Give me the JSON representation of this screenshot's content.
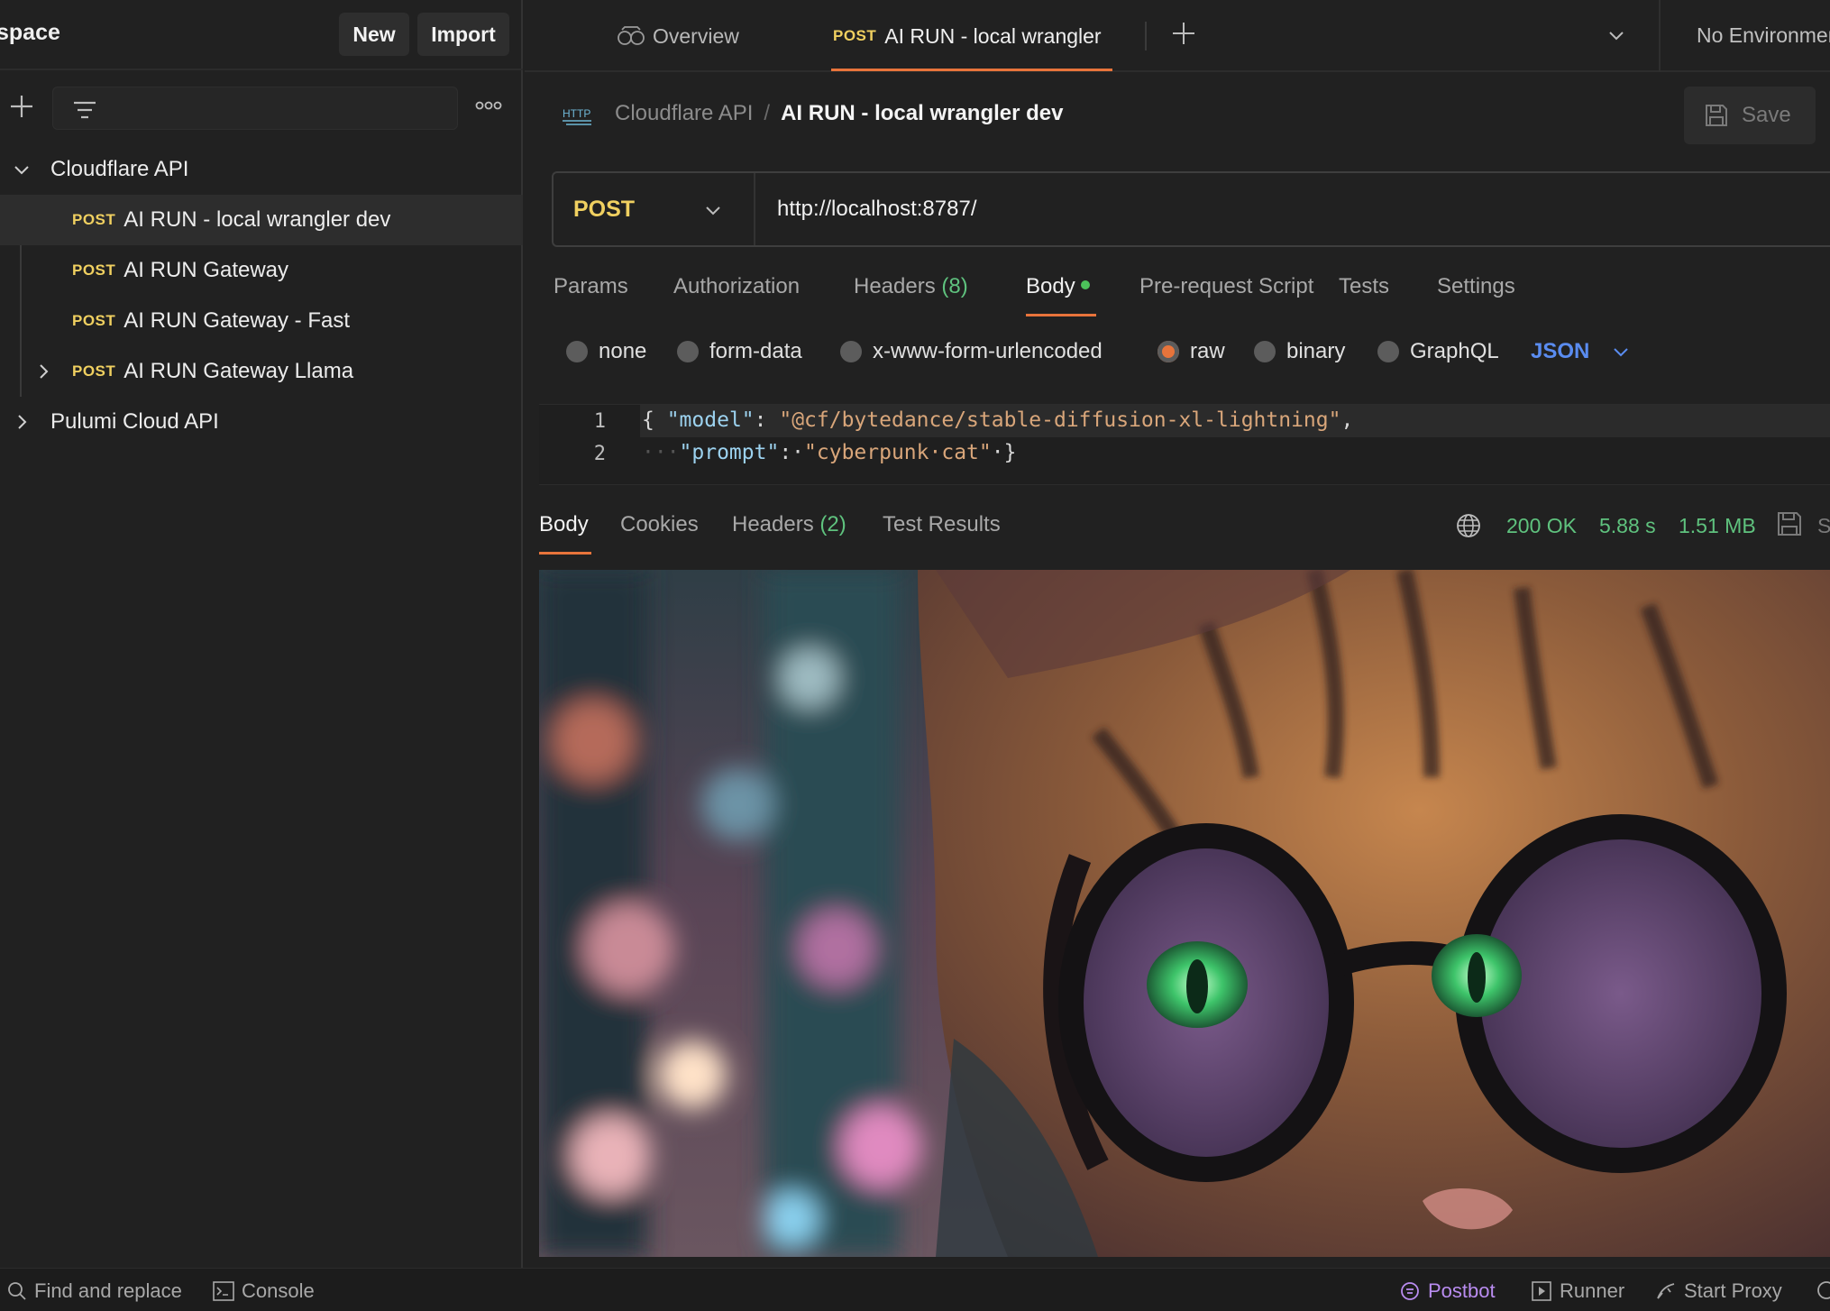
{
  "sidebar": {
    "workspace_title": "space",
    "new_label": "New",
    "import_label": "Import",
    "tree": [
      {
        "label": "Cloudflare API",
        "type": "collection",
        "expanded": true
      },
      {
        "method": "POST",
        "label": "AI RUN - local wrangler dev",
        "selected": true
      },
      {
        "method": "POST",
        "label": "AI RUN Gateway"
      },
      {
        "method": "POST",
        "label": "AI RUN Gateway - Fast"
      },
      {
        "method": "POST",
        "label": "AI RUN Gateway Llama",
        "expandable": true
      },
      {
        "label": "Pulumi Cloud API",
        "type": "collection",
        "expanded": false
      }
    ]
  },
  "tabs": {
    "overview_label": "Overview",
    "active_method": "POST",
    "active_label": "AI RUN - local wrangler",
    "environment": "No Environment"
  },
  "request": {
    "breadcrumb_parent": "Cloudflare API",
    "breadcrumb_separator": "/",
    "breadcrumb_current": "AI RUN - local wrangler dev",
    "http_icon_text": "HTTP",
    "save_label": "Save",
    "method": "POST",
    "url": "http://localhost:8787/",
    "subtabs": {
      "params": "Params",
      "authorization": "Authorization",
      "headers": "Headers",
      "headers_count": "(8)",
      "body": "Body",
      "prerequest": "Pre-request Script",
      "tests": "Tests",
      "settings": "Settings"
    },
    "body_types": {
      "none": "none",
      "form_data": "form-data",
      "urlencoded": "x-www-form-urlencoded",
      "raw": "raw",
      "binary": "binary",
      "graphql": "GraphQL",
      "selected": "raw",
      "format": "JSON"
    },
    "code": {
      "line1_no": "1",
      "line2_no": "2",
      "l1_open": "{ ",
      "l1_key": "\"model\"",
      "l1_colon": ": ",
      "l1_value": "\"@cf/bytedance/stable-diffusion-xl-lightning\"",
      "l1_comma": ",",
      "l2_indent": "···",
      "l2_key": "\"prompt\"",
      "l2_colon": ":·",
      "l2_value": "\"cyberpunk·cat\"",
      "l2_close": "·}"
    }
  },
  "response": {
    "tabs": {
      "body": "Body",
      "cookies": "Cookies",
      "headers": "Headers",
      "headers_count": "(2)",
      "test_results": "Test Results"
    },
    "status": "200 OK",
    "time": "5.88 s",
    "size": "1.51 MB",
    "save_partial": "S"
  },
  "statusbar": {
    "find_replace": "Find and replace",
    "console": "Console",
    "postbot": "Postbot",
    "runner": "Runner",
    "start_proxy": "Start Proxy"
  },
  "colors": {
    "accent": "#e8743b",
    "post_method": "#f0d060",
    "success": "#5fc27e",
    "json_blue": "#5a8cf0"
  }
}
